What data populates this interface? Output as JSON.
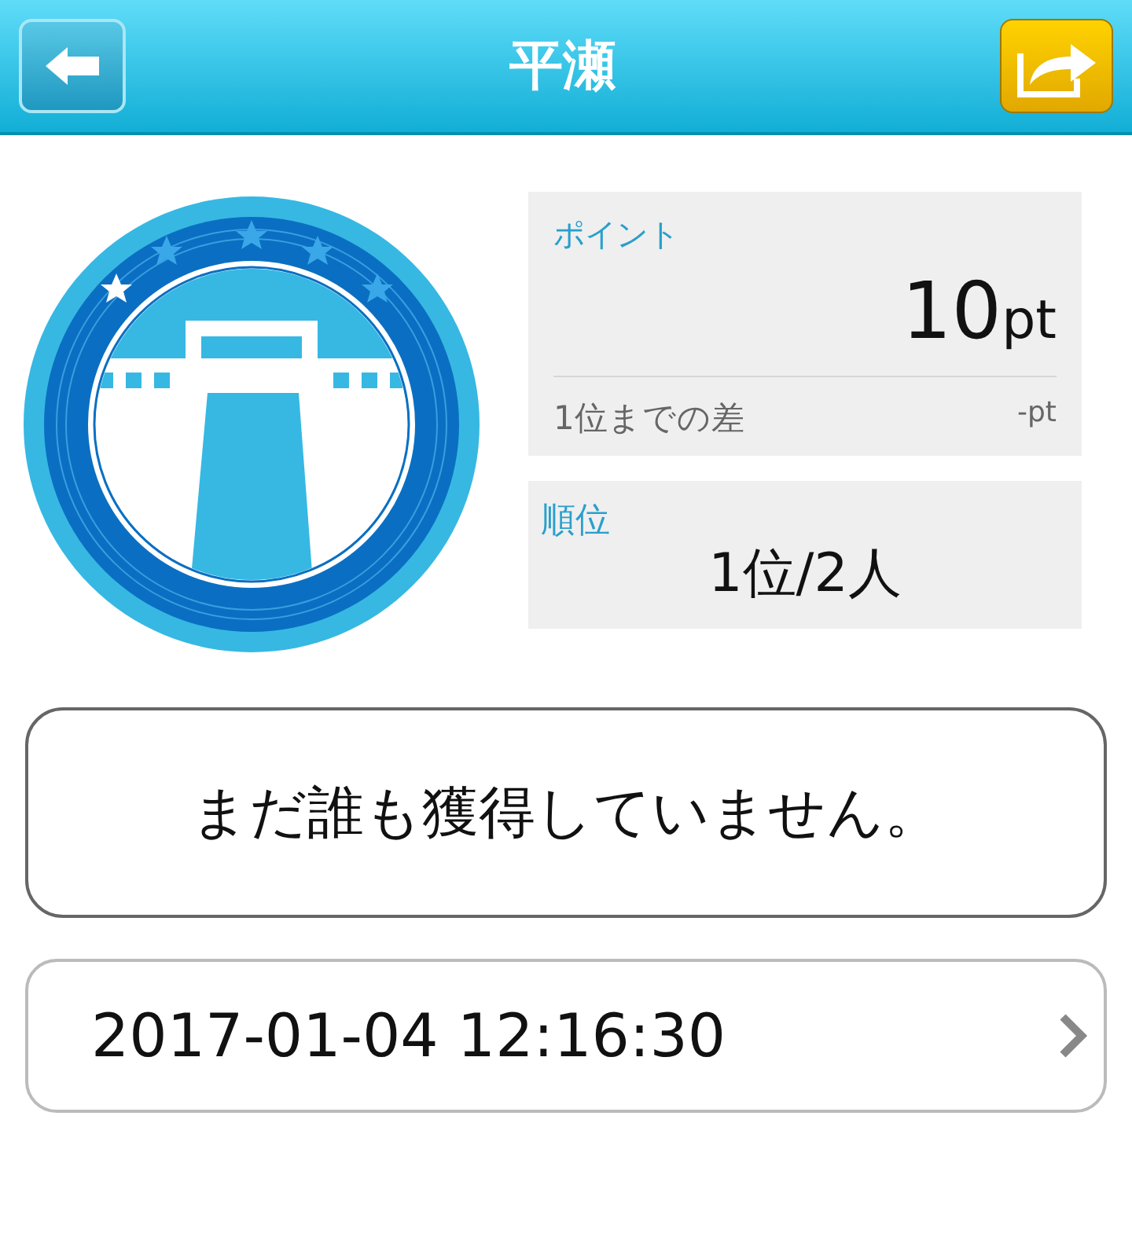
{
  "header": {
    "title": "平瀬"
  },
  "points": {
    "label": "ポイント",
    "value": "10",
    "unit": "pt",
    "gap_label": "1位までの差",
    "gap_value": "-pt"
  },
  "rank": {
    "label": "順位",
    "value": "1位/2人"
  },
  "message": "まだ誰も獲得していません。",
  "date_row": {
    "text": "2017-01-04 12:16:30"
  }
}
